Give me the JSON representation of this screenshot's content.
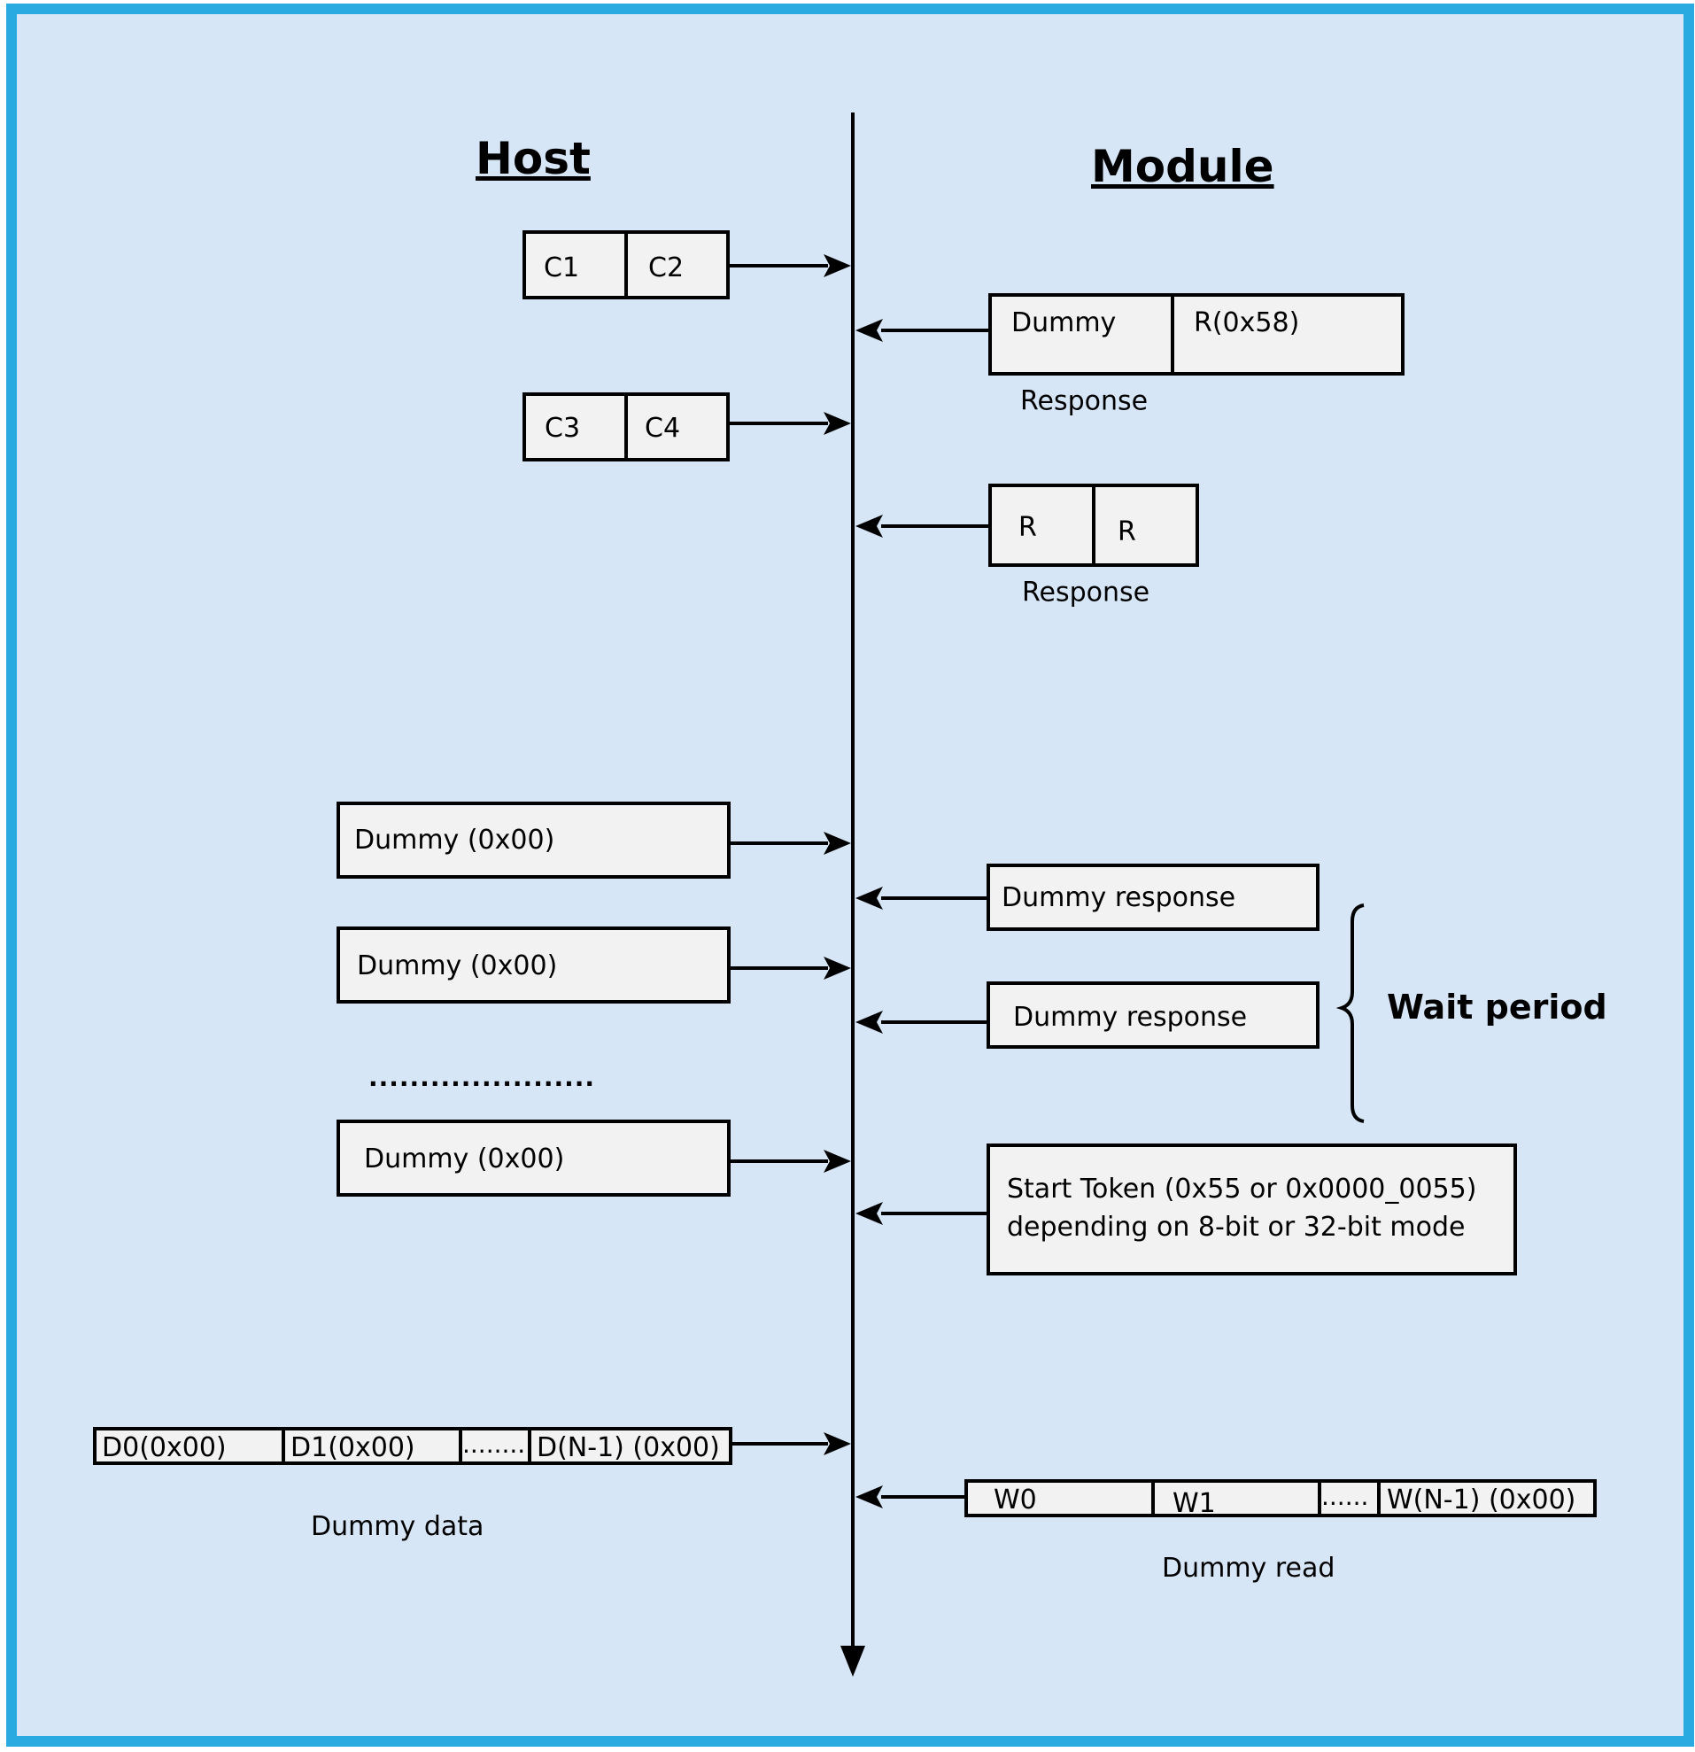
{
  "frame": {
    "border_color": "#29abe2",
    "background_color": "#d6e6f6",
    "box_fill": "#f2f2f2"
  },
  "headers": {
    "host": "Host",
    "module": "Module"
  },
  "host": {
    "command_1": {
      "cells": [
        "C1",
        "C2"
      ]
    },
    "command_2": {
      "cells": [
        "C3",
        "C4"
      ]
    },
    "dummy_1": "Dummy (0x00)",
    "dummy_2": "Dummy (0x00)",
    "ellipsis": "......................",
    "dummy_3": "Dummy (0x00)",
    "dummy_data": {
      "cells": [
        "D0(0x00)",
        "D1(0x00)",
        "........",
        "D(N-1) (0x00)"
      ],
      "caption": "Dummy data"
    }
  },
  "module": {
    "response_1": {
      "cells": [
        "Dummy",
        "R(0x58)"
      ],
      "caption": "Response"
    },
    "response_2": {
      "cells": [
        "R",
        "R"
      ],
      "caption": "Response"
    },
    "dummy_response_1": "Dummy response",
    "dummy_response_2": "Dummy response",
    "wait_period": "Wait period",
    "start_token": {
      "line_1": "Start Token (0x55 or 0x0000_0055)",
      "line_2": "depending on 8-bit or 32-bit mode"
    },
    "dummy_read": {
      "cells": [
        "W0",
        "W1",
        "......",
        "W(N-1) (0x00)"
      ],
      "caption": "Dummy read"
    }
  }
}
